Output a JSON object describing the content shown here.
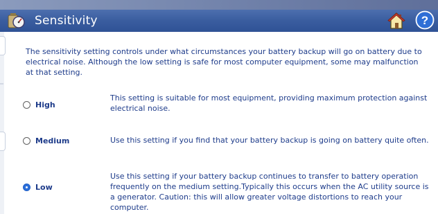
{
  "header": {
    "title": "Sensitivity",
    "icons": {
      "app": "battery-gauge-icon",
      "home": "home-icon",
      "help": "help-icon"
    }
  },
  "intro": "The sensitivity setting controls under what circumstances your battery backup will go on battery due to electrical noise. Although the low setting is safe for most computer equipment, some may malfunction at that setting.",
  "options": [
    {
      "label": "High",
      "selected": false,
      "description": "This setting is suitable for most equipment, providing maximum protection against electrical noise."
    },
    {
      "label": "Medium",
      "selected": false,
      "description": "Use this setting if you find that your battery backup is going on battery quite often."
    },
    {
      "label": "Low",
      "selected": true,
      "description": "Use this setting if your battery backup continues to transfer to battery operation frequently on the medium setting.Typically this occurs when the AC utility source is a generator. Caution: this will allow greater voltage distortions to reach your computer."
    }
  ],
  "colors": {
    "text": "#1d3b8a",
    "titlebar": "#3a5d9f",
    "radio_selected": "#2c6fd9"
  }
}
